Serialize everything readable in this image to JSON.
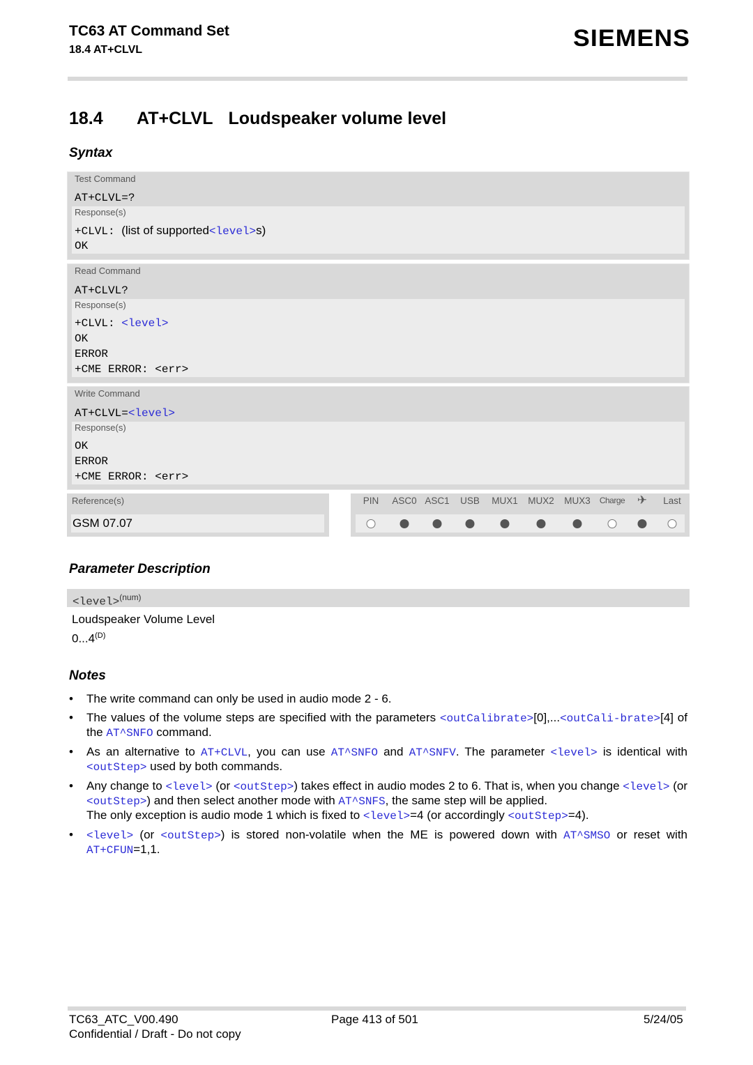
{
  "header": {
    "doc_title": "TC63 AT Command Set",
    "section_ref": "18.4 AT+CLVL",
    "logo": "SIEMENS"
  },
  "section": {
    "number": "18.4",
    "command": "AT+CLVL",
    "title": "Loudspeaker volume level"
  },
  "syntax": {
    "heading": "Syntax",
    "test": {
      "label": "Test Command",
      "command": "AT+CLVL=?",
      "response_label": "Response(s)",
      "resp_prefix": "+CLVL: ",
      "resp_text_a": "(list of supported",
      "resp_param": "<level>",
      "resp_text_b": "s)",
      "resp_ok": "OK"
    },
    "read": {
      "label": "Read Command",
      "command": "AT+CLVL?",
      "response_label": "Response(s)",
      "resp_prefix": "+CLVL: ",
      "resp_param": "<level>",
      "lines": [
        "OK",
        "ERROR",
        "+CME ERROR: <err>"
      ]
    },
    "write": {
      "label": "Write Command",
      "command_prefix": "AT+CLVL=",
      "command_param": "<level>",
      "response_label": "Response(s)",
      "lines": [
        "OK",
        "ERROR",
        "+CME ERROR: <err>"
      ]
    },
    "reference": {
      "label": "Reference(s)",
      "value": "GSM 07.07"
    },
    "pin_table": {
      "columns": [
        {
          "label": "PIN",
          "supported": false
        },
        {
          "label": "ASC0",
          "supported": true
        },
        {
          "label": "ASC1",
          "supported": true
        },
        {
          "label": "USB",
          "supported": true
        },
        {
          "label": "MUX1",
          "supported": true
        },
        {
          "label": "MUX2",
          "supported": true
        },
        {
          "label": "MUX3",
          "supported": true
        },
        {
          "label": "Charge",
          "supported": false
        },
        {
          "label": "✈",
          "icon": "airplane-icon",
          "supported": true
        },
        {
          "label": "Last",
          "supported": false
        }
      ]
    }
  },
  "parameters": {
    "heading": "Parameter Description",
    "items": [
      {
        "name": "<level>",
        "type": "(num)",
        "description": "Loudspeaker Volume Level",
        "range": "0...4",
        "range_sup": "(D)"
      }
    ]
  },
  "notes": {
    "heading": "Notes",
    "bullet": "•",
    "items": [
      [
        {
          "t": "The write command can only be used in audio mode 2 - 6."
        }
      ],
      [
        {
          "t": "The values of the volume steps are specified with the parameters "
        },
        {
          "l": "<outCalibrate>"
        },
        {
          "t": "[0],..."
        },
        {
          "l": "<outCali-brate>"
        },
        {
          "t": "[4] of the "
        },
        {
          "l": "AT^SNFO"
        },
        {
          "t": " command."
        }
      ],
      [
        {
          "t": "As an alternative to "
        },
        {
          "l": "AT+CLVL"
        },
        {
          "t": ", you can use "
        },
        {
          "l": "AT^SNFO"
        },
        {
          "t": " and "
        },
        {
          "l": "AT^SNFV"
        },
        {
          "t": ". The parameter "
        },
        {
          "l": "<level>"
        },
        {
          "t": " is identical with "
        },
        {
          "l": "<outStep>"
        },
        {
          "t": " used by both commands."
        }
      ],
      [
        {
          "t": "Any change to "
        },
        {
          "l": "<level>"
        },
        {
          "t": " (or "
        },
        {
          "l": "<outStep>"
        },
        {
          "t": ") takes effect in audio modes 2 to 6. That is, when you change "
        },
        {
          "l": "<level>"
        },
        {
          "t": " (or "
        },
        {
          "l": "<outStep>"
        },
        {
          "t": ") and then select another mode with "
        },
        {
          "l": "AT^SNFS"
        },
        {
          "t": ", the same step will be applied. "
        },
        {
          "br": true
        },
        {
          "t": "The only exception is audio mode 1 which is fixed to "
        },
        {
          "l": "<level>"
        },
        {
          "t": "=4 (or accordingly "
        },
        {
          "l": "<outStep>"
        },
        {
          "t": "=4)."
        }
      ],
      [
        {
          "l": "<level>"
        },
        {
          "t": " (or "
        },
        {
          "l": "<outStep>"
        },
        {
          "t": ") is stored non-volatile when the ME is powered down with "
        },
        {
          "l": "AT^SMSO"
        },
        {
          "t": " or reset with "
        },
        {
          "l": "AT+CFUN"
        },
        {
          "t": "=1,1."
        }
      ]
    ]
  },
  "footer": {
    "doc_id": "TC63_ATC_V00.490",
    "page": "Page 413 of 501",
    "date": "5/24/05",
    "confidentiality": "Confidential / Draft - Do not copy"
  }
}
